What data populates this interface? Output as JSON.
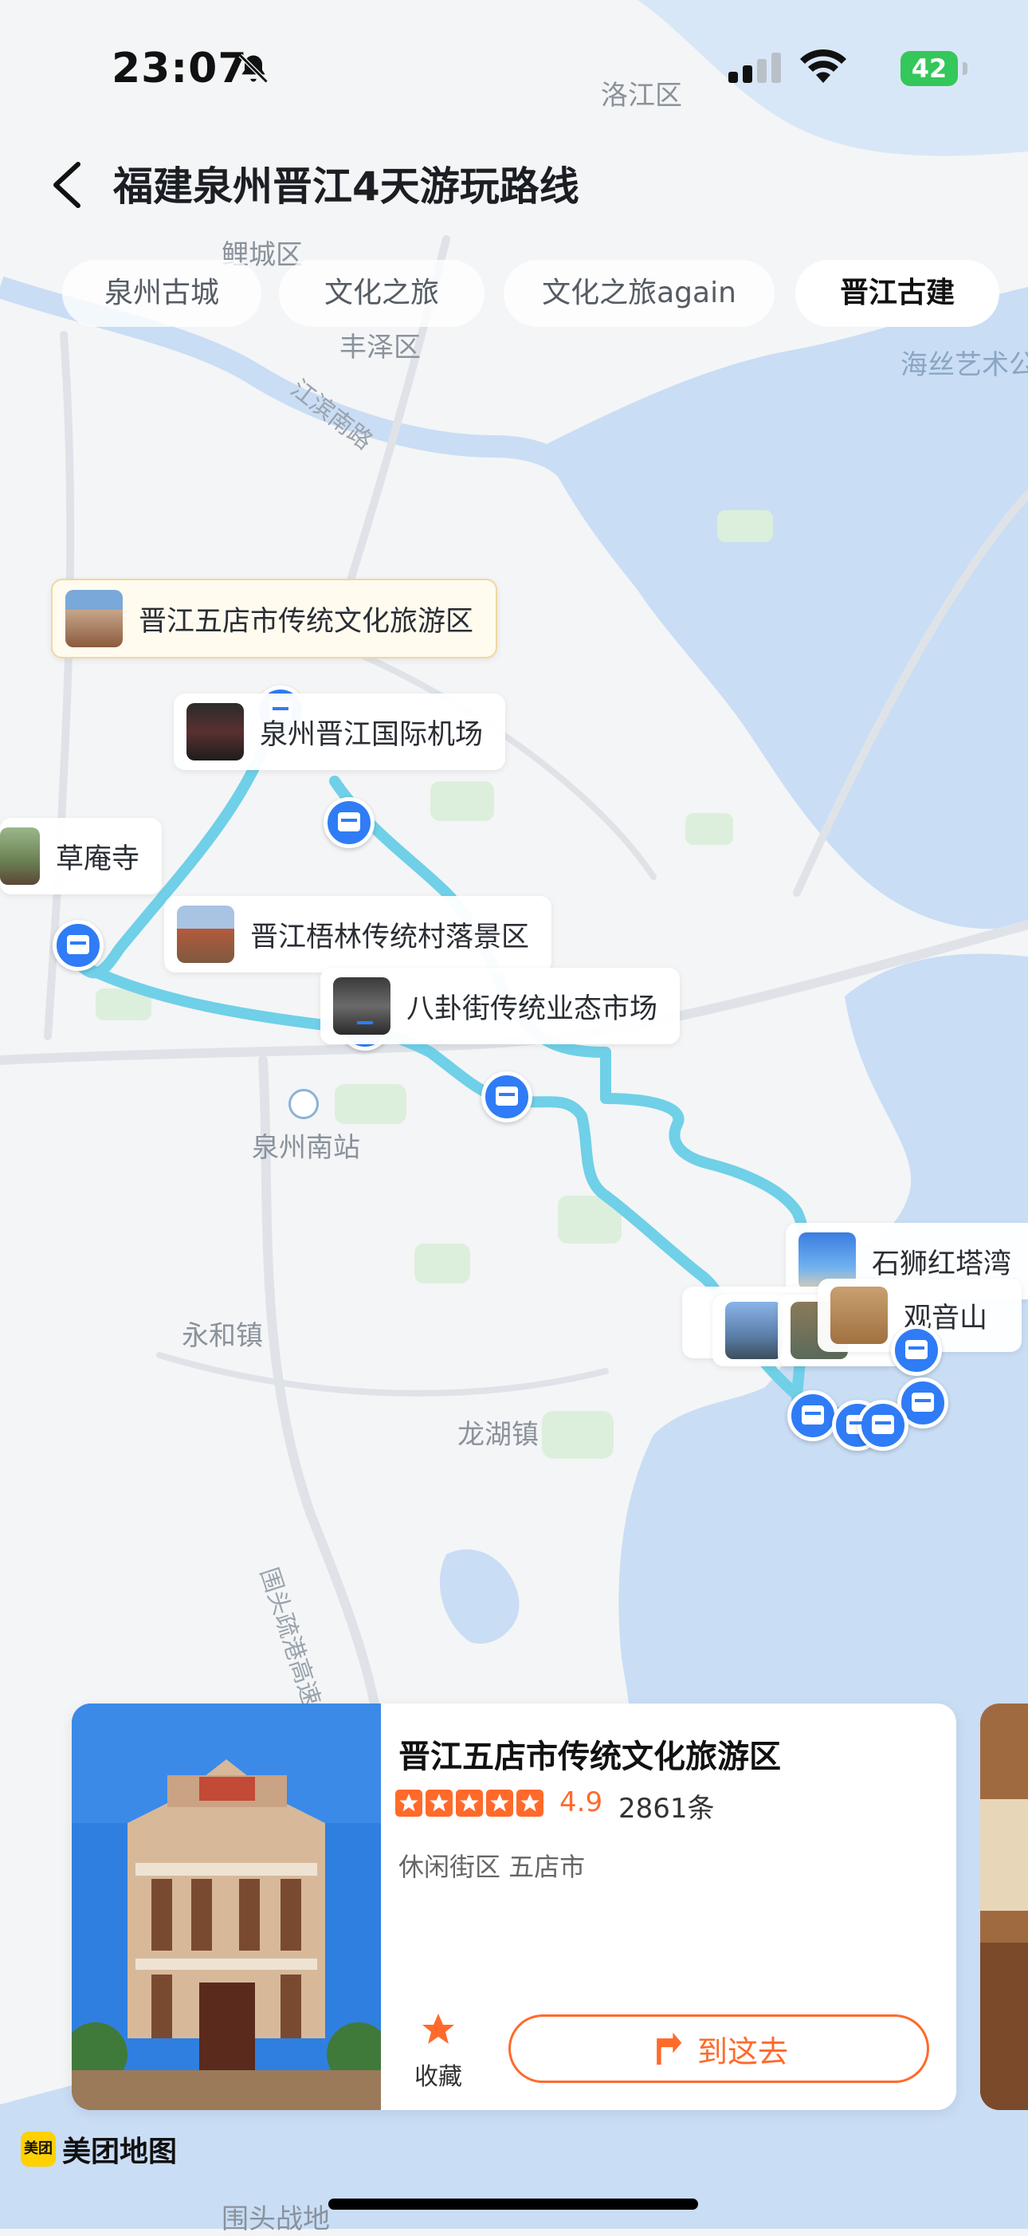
{
  "status_bar": {
    "time": "23:07",
    "battery": "42"
  },
  "header": {
    "title": "福建泉州晋江4天游玩路线"
  },
  "tabs": [
    {
      "label": "泉州古城",
      "active": false
    },
    {
      "label": "文化之旅",
      "active": false
    },
    {
      "label": "文化之旅again",
      "active": false
    },
    {
      "label": "晋江古建",
      "active": true
    }
  ],
  "map_labels": {
    "luojiang": "洛江区",
    "licheng": "鲤城区",
    "fengze": "丰泽区",
    "jiangbin_road": "江滨南路",
    "haisi": "海丝艺术公",
    "quanzhou_south": "泉州南站",
    "yonghe": "永和镇",
    "longhu": "龙湖镇",
    "weitou_expressway": "围头疏港高速",
    "weitou_battlefield": "围头战地"
  },
  "pois": [
    {
      "name": "晋江五店市传统文化旅游区",
      "highlight": true
    },
    {
      "name": "泉州晋江国际机场"
    },
    {
      "name": "草庵寺"
    },
    {
      "name": "晋江梧林传统村落景区"
    },
    {
      "name": "八卦街传统业态市场"
    },
    {
      "name": "石狮红塔湾"
    },
    {
      "name": "观音山"
    }
  ],
  "card": {
    "name": "晋江五店市传统文化旅游区",
    "rating": "4.9",
    "stars": 5,
    "reviews": "2861条",
    "category": "休闲街区  五店市",
    "favorite_label": "收藏",
    "goto_label": "到这去"
  },
  "brand": {
    "name": "美团地图",
    "icon_text": "美团"
  },
  "colors": {
    "accent": "#ff6a2b",
    "route": "#6fd0e8",
    "pin": "#2f7cf6",
    "water": "#c9ddf5"
  }
}
